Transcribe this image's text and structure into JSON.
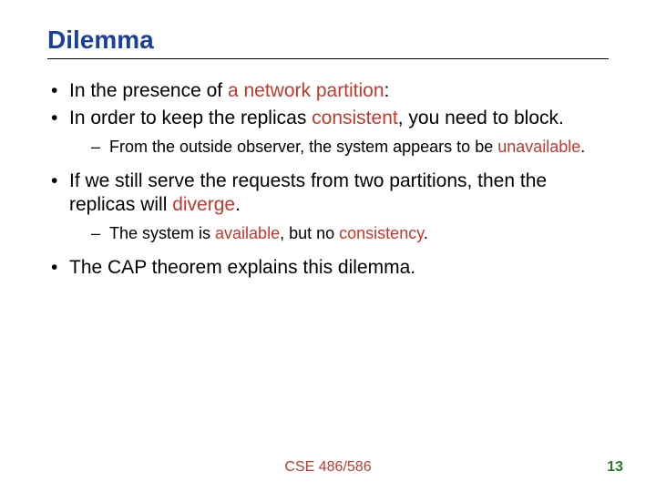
{
  "title": "Dilemma",
  "bullets": {
    "b1_pre": "In the presence of ",
    "b1_hl": "a network partition",
    "b1_post": ":",
    "b2_pre": "In order to keep the replicas ",
    "b2_hl": "consistent",
    "b2_post": ", you need to block.",
    "b2_sub_pre": "From the outside observer, the system appears to be ",
    "b2_sub_hl": "unavailable",
    "b2_sub_post": ".",
    "b3_pre": "If we still serve the requests from two partitions, then the replicas will ",
    "b3_hl": "diverge",
    "b3_post": ".",
    "b3_sub_pre": "The system is ",
    "b3_sub_hl1": "available",
    "b3_sub_mid": ", but no ",
    "b3_sub_hl2": "consistency",
    "b3_sub_post": ".",
    "b4": "The CAP theorem explains this dilemma."
  },
  "footer": {
    "center": "CSE 486/586",
    "pageNumber": "13"
  }
}
